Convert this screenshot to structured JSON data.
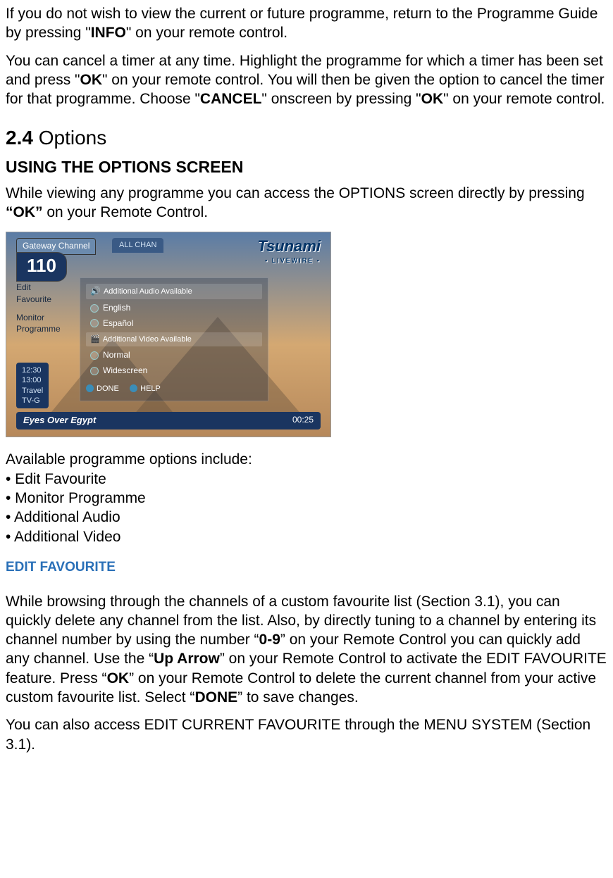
{
  "para1": {
    "t1": "If you do not wish to view the current or future programme, return to the Programme Guide by pressing \"",
    "b1": "INFO",
    "t2": "\" on your remote control."
  },
  "para2": {
    "t1": "You can cancel a timer at any time.   Highlight the programme for which a timer has been set and press \"",
    "b1": "OK",
    "t2": "\" on your remote control.   You will then be given the option to cancel the timer for that programme.   Choose \"",
    "b2": "CANCEL",
    "t3": "\" onscreen by pressing \"",
    "b3": "OK",
    "t4": "\" on your remote control."
  },
  "h2": {
    "num": "2.4",
    "title": " Options"
  },
  "h3": "USING THE OPTIONS SCREEN",
  "para3": {
    "t1": "While viewing any programme you can access the OPTIONS screen directly by pressing ",
    "b1": "“OK”",
    "t2": " on your Remote Control."
  },
  "scr": {
    "gateway": "Gateway Channel",
    "allchan": "ALL CHAN",
    "chnum": "110",
    "logo": "Tsunami",
    "logosub": "▪ LIVEWIRE ▪",
    "side1": "Edit\nFavourite",
    "side2": "Monitor\nProgramme",
    "time1": "12:30",
    "time2": "13:00",
    "time3": "Travel",
    "time4": "TV-G",
    "audio_hdr": "Additional Audio Available",
    "audio1": "English",
    "audio2": "Español",
    "video_hdr": "Additional Video Available",
    "video1": "Normal",
    "video2": "Widescreen",
    "done": "DONE",
    "help": "HELP",
    "prog": "Eyes Over Egypt",
    "dur": "00:25"
  },
  "avail": "Available programme options include:",
  "bullets": {
    "b1": "• Edit Favourite",
    "b2": "• Monitor Programme",
    "b3": "• Additional Audio",
    "b4": "• Additional Video"
  },
  "bluehead": "EDIT FAVOURITE",
  "para4": {
    "t1": "While browsing through the channels of a custom favourite list (Section 3.1), you can quickly delete any channel from the list. Also, by directly tuning to a channel by entering its channel number by using the number “",
    "b1": "0-9",
    "t2": "” on your Remote Control you can quickly add any channel. Use the “",
    "b2": "Up Arrow",
    "t3": "” on your Remote Control to activate the EDIT FAVOURITE feature. Press “",
    "b3": "OK",
    "t4": "” on your Remote Control to delete the current channel from your active custom favourite list. Select “",
    "b4": "DONE",
    "t5": "” to save changes."
  },
  "para5": "You can also access EDIT CURRENT FAVOURITE through the MENU SYSTEM (Section 3.1)."
}
